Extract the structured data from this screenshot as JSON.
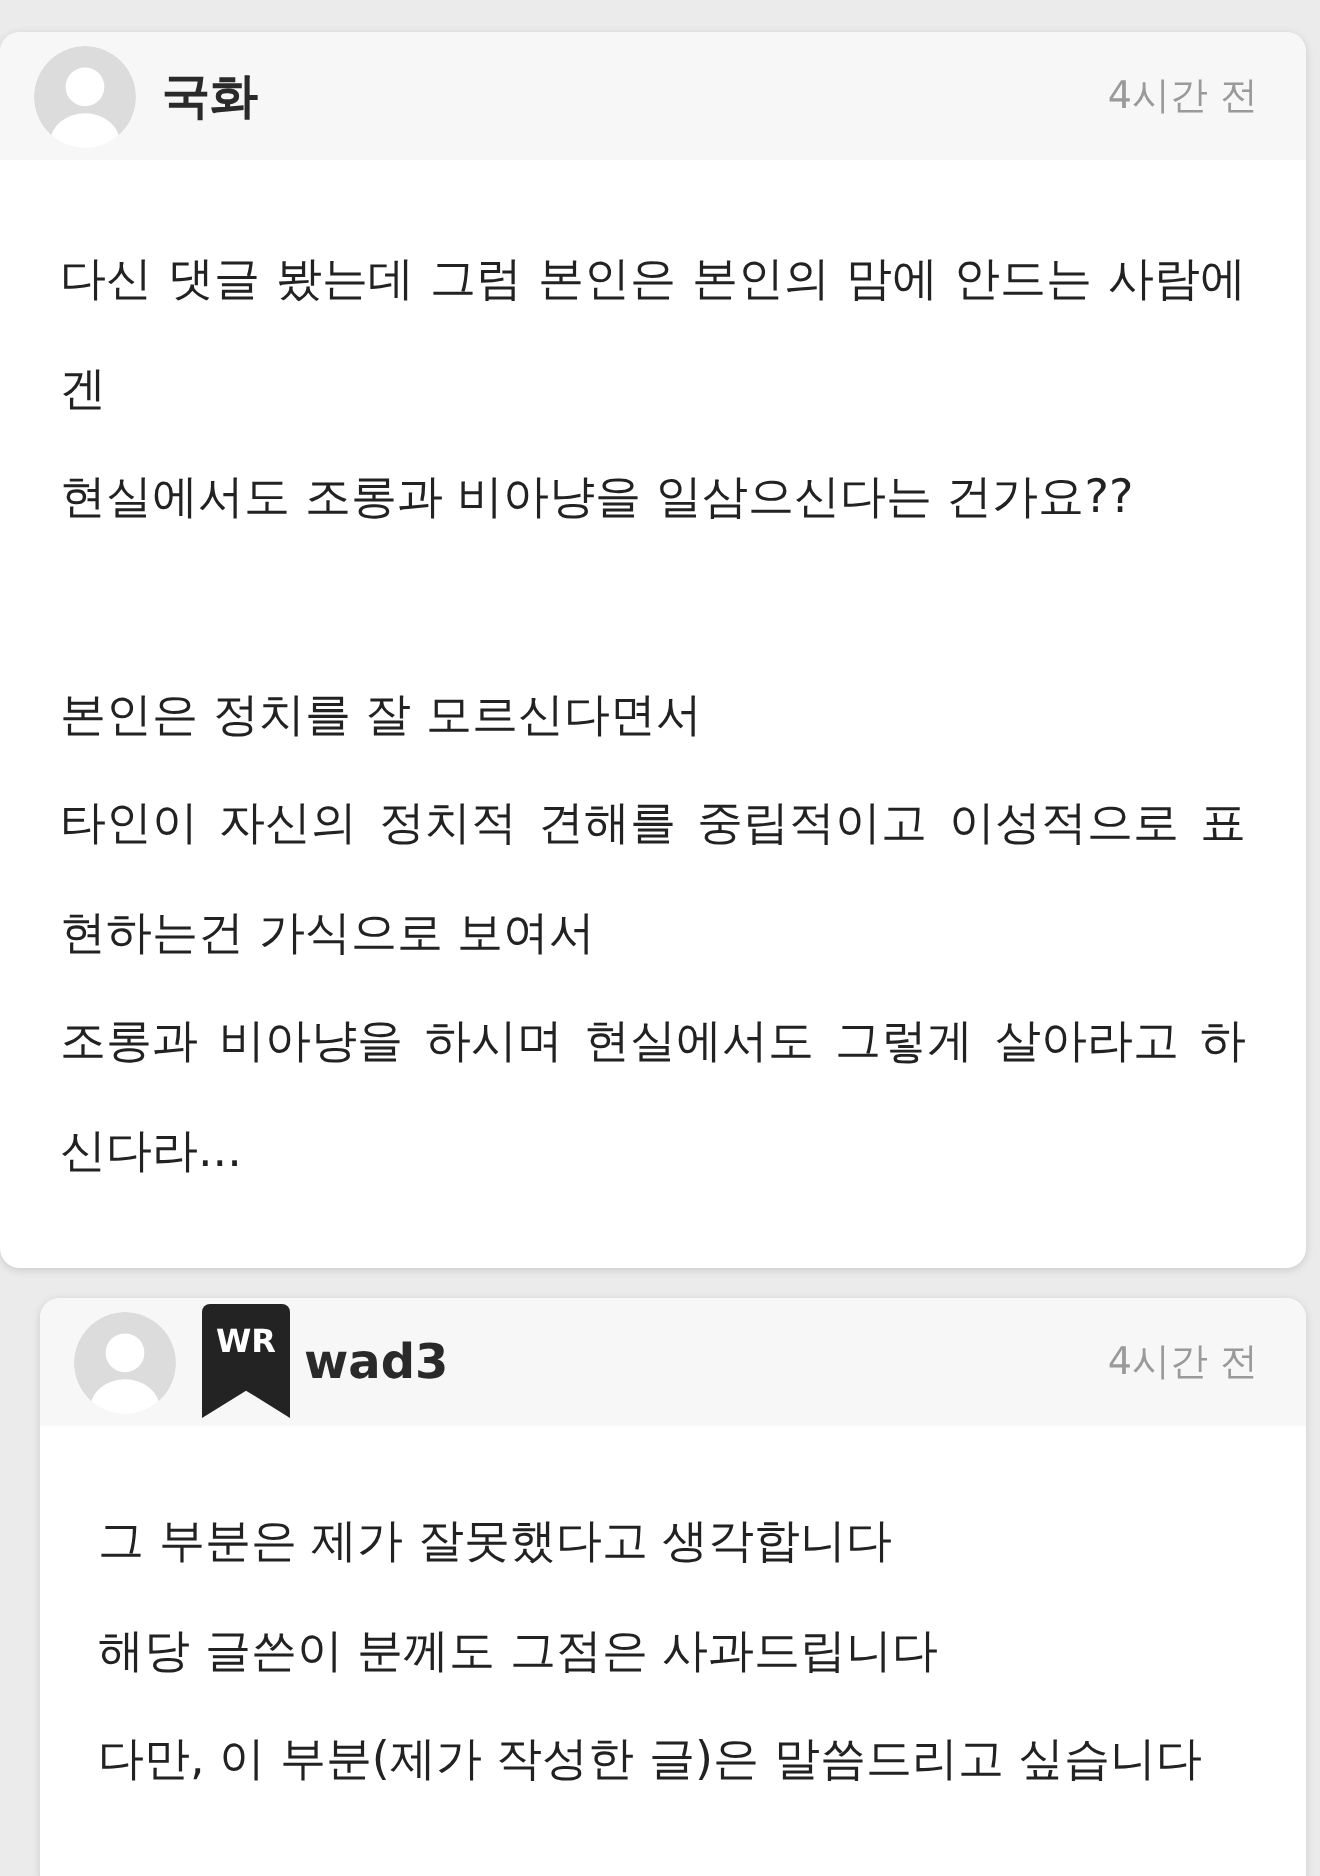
{
  "comments": [
    {
      "kind": "comment",
      "author": "국화",
      "time": "4시간 전",
      "paragraphs": [
        [
          "다신 댓글 봤는데 그럼 본인은 본인의 맘에 안드는 사람에겐",
          "현실에서도 조롱과 비아냥을 일삼으신다는 건가요??"
        ],
        [
          "본인은 정치를 잘 모르신다면서",
          "타인이 자신의 정치적 견해를 중립적이고 이성적으로 표현하는건 가식으로 보여서",
          "조롱과 비아냥을 하시며 현실에서도 그렇게 살아라고 하신다라..."
        ]
      ]
    },
    {
      "kind": "reply",
      "badge": "WR",
      "author": "wad3",
      "time": "4시간 전",
      "paragraphs": [
        [
          "그 부분은 제가 잘못했다고 생각합니다",
          "해당 글쓴이 분께도 그점은 사과드립니다",
          "다만, 이 부분(제가 작성한 글)은 말씀드리고 싶습니다"
        ]
      ]
    }
  ]
}
